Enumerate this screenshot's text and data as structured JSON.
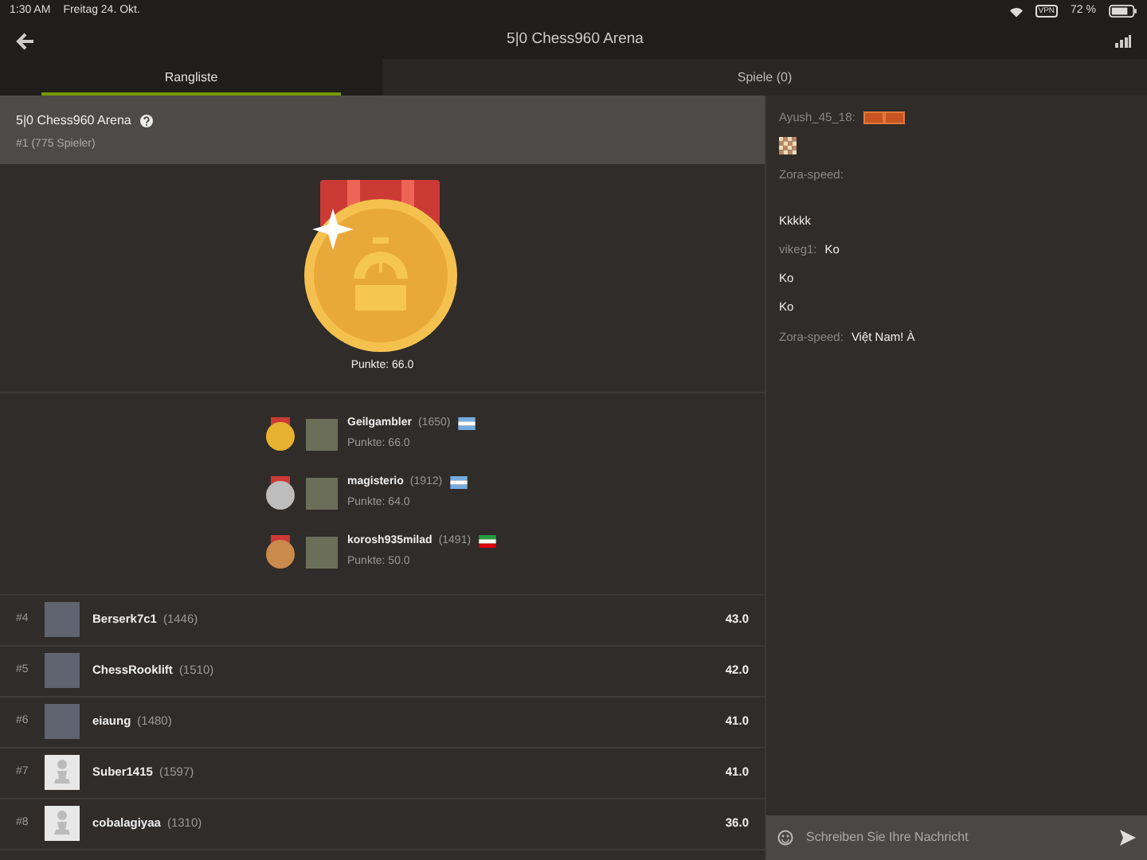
{
  "status_bar": {
    "time": "1:30 AM",
    "date": "Freitag 24. Okt.",
    "vpn": "VPN",
    "battery": "72 %"
  },
  "header": {
    "title": "5|0 Chess960 Arena"
  },
  "tabs": [
    {
      "label": "Rangliste",
      "selected": true
    },
    {
      "label": "Spiele (0)",
      "selected": false
    }
  ],
  "tournament": {
    "name": "5|0 Chess960 Arena",
    "rank": "#1 (775 Spieler)",
    "points": "Punkte: 66.0"
  },
  "podium": [
    {
      "name": "Geilgambler",
      "rating": "(1650)",
      "points": "Punkte: 66.0",
      "color": "#e8b130",
      "flag": {
        "kind": "argentina"
      }
    },
    {
      "name": "magisterio",
      "rating": "(1912)",
      "points": "Punkte: 64.0",
      "color": "#bdbdbd",
      "flag": {
        "kind": "argentina"
      }
    },
    {
      "name": "korosh935milad",
      "rating": "(1491)",
      "points": "Punkte: 50.0",
      "color": "#c98a4b",
      "flag": {
        "kind": "iran"
      }
    }
  ],
  "standings": [
    {
      "rank": "#4",
      "name": "Berserk7c1",
      "rating": "(1446)",
      "score": "43.0",
      "kind": "photo"
    },
    {
      "rank": "#5",
      "name": "ChessRooklift",
      "rating": "(1510)",
      "score": "42.0",
      "kind": "photo"
    },
    {
      "rank": "#6",
      "name": "eiaung",
      "rating": "(1480)",
      "score": "41.0",
      "kind": "photo"
    },
    {
      "rank": "#7",
      "name": "Suber1415",
      "rating": "(1597)",
      "score": "41.0",
      "kind": "default"
    },
    {
      "rank": "#8",
      "name": "cobalagiyaa",
      "rating": "(1310)",
      "score": "36.0",
      "kind": "default"
    }
  ],
  "chat": {
    "messages": [
      {
        "author": "Ayush_45_18:",
        "kind": "badges"
      },
      {
        "kind": "board"
      },
      {
        "author": "Zora-speed:",
        "kind": "text"
      },
      {
        "text": "Kkkkk",
        "kind": "text"
      },
      {
        "author": "vikeg1:",
        "text": "Ko",
        "kind": "text"
      },
      {
        "text": "Ko",
        "kind": "text"
      },
      {
        "text": "Ko",
        "kind": "text"
      },
      {
        "author": "Zora-speed:",
        "text": "Việt Nam! À",
        "kind": "text"
      }
    ],
    "input": {
      "placeholder": "Schreiben Sie Ihre Nachricht"
    }
  }
}
